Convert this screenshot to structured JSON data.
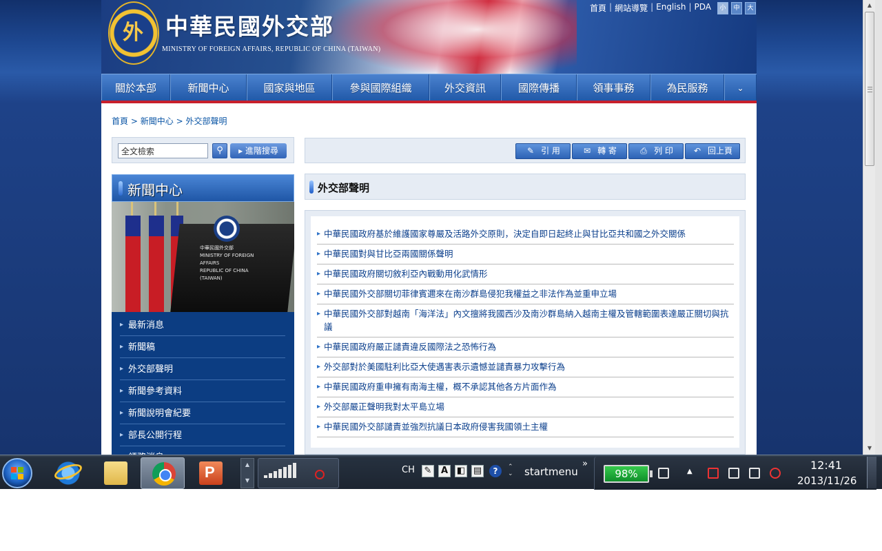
{
  "header": {
    "site_title": "中華民國外交部",
    "site_subtitle": "MINISTRY OF FOREIGN AFFAIRS, REPUBLIC OF CHINA (TAIWAN)",
    "logo_glyph": "外",
    "top_links": [
      "首頁",
      "網站導覽",
      "English",
      "PDA"
    ],
    "font_sizes": [
      "小",
      "中",
      "大"
    ]
  },
  "nav": {
    "items": [
      "關於本部",
      "新聞中心",
      "國家與地區",
      "參與國際組織",
      "外交資訊",
      "國際傳播",
      "領事事務",
      "為民服務"
    ],
    "more_icon": "double-chevron-down-icon"
  },
  "breadcrumb": {
    "home": "首頁",
    "sep": ">",
    "section": "新聞中心",
    "current": "外交部聲明"
  },
  "search": {
    "placeholder": "全文檢索",
    "value": "全文檢索",
    "button_icon": "magnifier-icon",
    "advanced_label": "進階搜尋"
  },
  "sidebar": {
    "title": "新聞中心",
    "photo_caption": [
      "中華民國外交部",
      "MINISTRY OF FOREIGN AFFAIRS",
      "REPUBLIC OF CHINA (TAIWAN)"
    ],
    "items": [
      "最新消息",
      "新聞稿",
      "外交部聲明",
      "新聞參考資料",
      "新聞說明會紀要",
      "部長公開行程",
      "領務消息"
    ]
  },
  "toolbar": {
    "buttons": [
      {
        "label": "引 用",
        "icon": "quote-icon"
      },
      {
        "label": "轉 寄",
        "icon": "mail-icon"
      },
      {
        "label": "列 印",
        "icon": "printer-icon"
      },
      {
        "label": "回上頁",
        "icon": "back-arrow-icon"
      }
    ]
  },
  "section": {
    "title": "外交部聲明"
  },
  "news": [
    "中華民國政府基於維護國家尊嚴及活路外交原則，決定自即日起終止與甘比亞共和國之外交關係",
    "中華民國對與甘比亞兩國關係聲明",
    "中華民國政府關切敘利亞內戰動用化武情形",
    "中華民國外交部關切菲律賓邇來在南沙群島侵犯我權益之非法作為並重申立場",
    "中華民國外交部對越南「海洋法」內文擅將我國西沙及南沙群島納入越南主權及管轄範圍表達嚴正關切與抗議",
    "中華民國政府嚴正譴責違反國際法之恐怖行為",
    "外交部對於美國駐利比亞大使遇害表示遺憾並譴責暴力攻擊行為",
    "中華民國政府重申擁有南海主權，概不承認其他各方片面作為",
    "外交部嚴正聲明我對太平島立場",
    "中華民國外交部譴責並強烈抗議日本政府侵害我國領土主權"
  ],
  "taskbar": {
    "ime": "CH",
    "startmenu_label": "startmenu",
    "overflow": "»",
    "battery": "98%",
    "time": "12:41",
    "date": "2013/11/26",
    "apps": [
      "internet-explorer-icon",
      "file-explorer-icon",
      "chrome-icon",
      "powerpoint-icon"
    ]
  },
  "colors": {
    "accent": "#2058a8",
    "nav_red": "#c8202c",
    "link": "#0a55a5",
    "battery": "#1fb23c"
  }
}
